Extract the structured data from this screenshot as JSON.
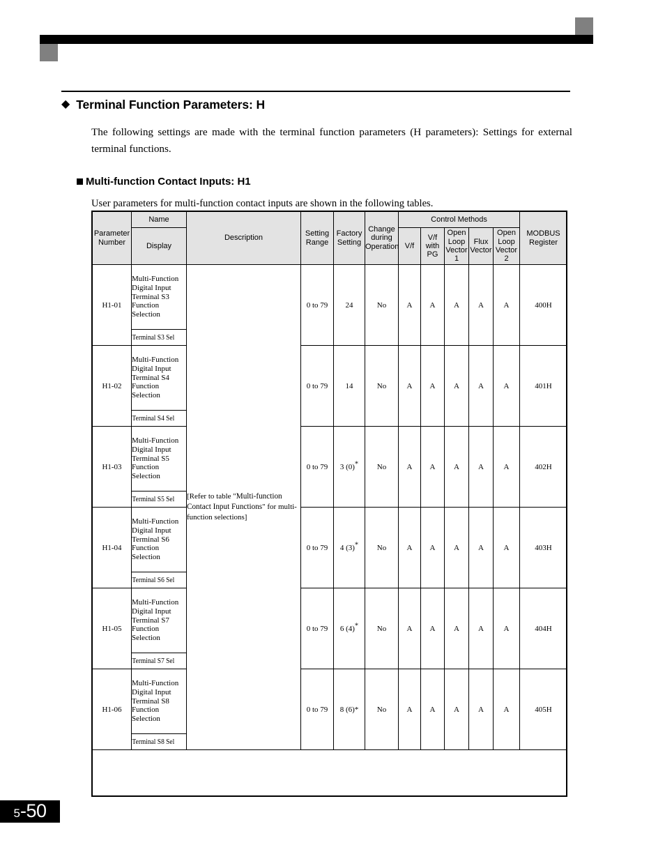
{
  "page": {
    "number_prefix": "5",
    "number_suffix": "-50"
  },
  "header_decoration": {
    "bar_color": "#000000",
    "square_color": "#808080"
  },
  "section": {
    "bullet_icon": "◆",
    "title": "Terminal Function Parameters: H",
    "intro": "The following settings are made with the terminal function parameters (H parameters): Settings for external terminal functions."
  },
  "subsection": {
    "bullet_icon": "square-bullet",
    "title": "Multi-function Contact Inputs: H1",
    "intro": "User parameters for multi-function contact inputs are shown in the following tables."
  },
  "table": {
    "headers": {
      "parameter_number": "Parameter\nNumber",
      "name_group": "Name",
      "display": "Display",
      "description": "Description",
      "setting_range": "Setting\nRange",
      "factory_setting": "Factory\nSetting",
      "change_during_operation": "Change\nduring\nOperation",
      "control_methods": "Control Methods",
      "control_vf": "V/f",
      "control_vf_pg": "V/f\nwith\nPG",
      "control_olv1": "Open\nLoop\nVector\n1",
      "control_flux": "Flux\nVector",
      "control_olv2": "Open\nLoop\nVector\n2",
      "modbus_register": "MODBUS\nRegister"
    },
    "header_labels": {
      "parameter_number_line1": "Parameter",
      "parameter_number_line2": "Number",
      "setting_range_line1": "Setting",
      "setting_range_line2": "Range",
      "factory_setting_line1": "Factory",
      "factory_setting_line2": "Setting",
      "change_line1": "Change",
      "change_line2": "during",
      "change_line3": "Operation",
      "vf_pg_line1": "V/f",
      "vf_pg_line2": "with",
      "vf_pg_line3": "PG",
      "olv1_line1": "Open",
      "olv1_line2": "Loop",
      "olv1_line3": "Vector",
      "olv1_line4": "1",
      "flux_line1": "Flux",
      "flux_line2": "Vector",
      "olv2_line1": "Open",
      "olv2_line2": "Loop",
      "olv2_line3": "Vector",
      "olv2_line4": "2",
      "modbus_line1": "MODBUS",
      "modbus_line2": "Register"
    },
    "description": {
      "part1": "[Refer to table \"",
      "part2": "Multi-function Contact Input Functions",
      "part3": "\" for multi-function selections]"
    },
    "rows": [
      {
        "parameter_number": "H1-01",
        "name": "Multi-Function Digital Input Terminal S3 Function Selection",
        "display": "Terminal S3 Sel",
        "setting_range": "0 to 79",
        "factory_setting": "24",
        "factory_setting_star": "",
        "change_during_operation": "No",
        "vf": "A",
        "vf_pg": "A",
        "olv1": "A",
        "flux": "A",
        "olv2": "A",
        "modbus_register": "400H"
      },
      {
        "parameter_number": "H1-02",
        "name": "Multi-Function Digital Input Terminal S4 Function Selection",
        "display": "Terminal S4 Sel",
        "setting_range": "0 to 79",
        "factory_setting": "14",
        "factory_setting_star": "",
        "change_during_operation": "No",
        "vf": "A",
        "vf_pg": "A",
        "olv1": "A",
        "flux": "A",
        "olv2": "A",
        "modbus_register": "401H"
      },
      {
        "parameter_number": "H1-03",
        "name": "Multi-Function Digital Input Terminal S5 Function Selection",
        "display": "Terminal S5 Sel",
        "setting_range": "0 to 79",
        "factory_setting": "3 (0)",
        "factory_setting_star": "*",
        "change_during_operation": "No",
        "vf": "A",
        "vf_pg": "A",
        "olv1": "A",
        "flux": "A",
        "olv2": "A",
        "modbus_register": "402H"
      },
      {
        "parameter_number": "H1-04",
        "name": "Multi-Function Digital Input Terminal S6 Function Selection",
        "display": "Terminal S6 Sel",
        "setting_range": "0 to 79",
        "factory_setting": "4 (3)",
        "factory_setting_star": "*",
        "change_during_operation": "No",
        "vf": "A",
        "vf_pg": "A",
        "olv1": "A",
        "flux": "A",
        "olv2": "A",
        "modbus_register": "403H"
      },
      {
        "parameter_number": "H1-05",
        "name": "Multi-Function Digital Input Terminal S7 Function Selection",
        "display": "Terminal S7 Sel",
        "setting_range": "0 to 79",
        "factory_setting": "6 (4)",
        "factory_setting_star": "*",
        "change_during_operation": "No",
        "vf": "A",
        "vf_pg": "A",
        "olv1": "A",
        "flux": "A",
        "olv2": "A",
        "modbus_register": "404H"
      },
      {
        "parameter_number": "H1-06",
        "name": "Multi-Function Digital Input Terminal S8 Function Selection",
        "display": "Terminal S8 Sel",
        "setting_range": "0 to 79",
        "factory_setting": "8 (6)*",
        "factory_setting_star": "",
        "change_during_operation": "No",
        "vf": "A",
        "vf_pg": "A",
        "olv1": "A",
        "flux": "A",
        "olv2": "A",
        "modbus_register": "405H"
      }
    ]
  }
}
